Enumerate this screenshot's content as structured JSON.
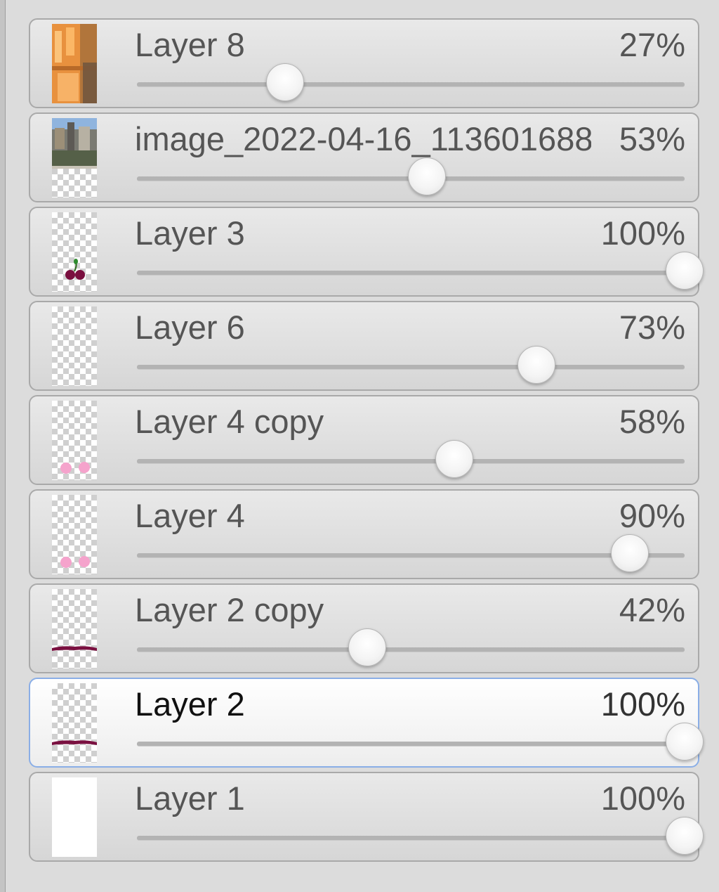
{
  "layers_panel": {
    "layers": [
      {
        "name": "Layer 8",
        "opacity_label": "27%",
        "opacity": 0.27,
        "selected": false,
        "thumbnail": "orange-photo"
      },
      {
        "name": "image_2022-04-16_113601688",
        "opacity_label": "53%",
        "opacity": 0.53,
        "selected": false,
        "thumbnail": "street-photo"
      },
      {
        "name": "Layer 3",
        "opacity_label": "100%",
        "opacity": 1.0,
        "selected": false,
        "thumbnail": "cherries"
      },
      {
        "name": "Layer 6",
        "opacity_label": "73%",
        "opacity": 0.73,
        "selected": false,
        "thumbnail": "empty"
      },
      {
        "name": "Layer 4 copy",
        "opacity_label": "58%",
        "opacity": 0.58,
        "selected": false,
        "thumbnail": "pink-dots"
      },
      {
        "name": "Layer 4",
        "opacity_label": "90%",
        "opacity": 0.9,
        "selected": false,
        "thumbnail": "pink-dots"
      },
      {
        "name": "Layer 2 copy",
        "opacity_label": "42%",
        "opacity": 0.42,
        "selected": false,
        "thumbnail": "dark-stroke"
      },
      {
        "name": "Layer 2",
        "opacity_label": "100%",
        "opacity": 1.0,
        "selected": true,
        "thumbnail": "dark-stroke"
      },
      {
        "name": "Layer 1",
        "opacity_label": "100%",
        "opacity": 1.0,
        "selected": false,
        "thumbnail": "white-fill"
      }
    ]
  },
  "colors": {
    "selected_border": "#8aaee6",
    "stroke_color": "#7a1040",
    "pink_dots": "#f5a3cc",
    "orange_photo": "#f0a050"
  }
}
